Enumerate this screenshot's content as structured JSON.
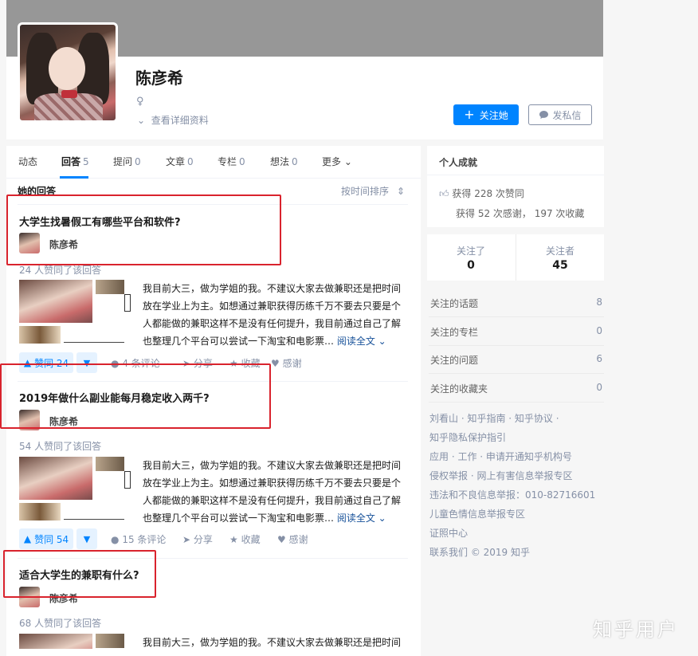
{
  "profile": {
    "name": "陈彦希",
    "gender_symbol": "♀",
    "detail_link": "查看详细资料",
    "follow_button": "关注她",
    "message_button": "发私信"
  },
  "tabs": [
    {
      "label": "动态",
      "count": ""
    },
    {
      "label": "回答",
      "count": "5"
    },
    {
      "label": "提问",
      "count": "0"
    },
    {
      "label": "文章",
      "count": "0"
    },
    {
      "label": "专栏",
      "count": "0"
    },
    {
      "label": "想法",
      "count": "0"
    },
    {
      "label": "更多",
      "count": ""
    }
  ],
  "list": {
    "title": "她的回答",
    "sort": "按时间排序"
  },
  "answers": [
    {
      "question": "大学生找暑假工有哪些平台和软件?",
      "author": "陈彦希",
      "upvote_info": "24 人赞同了该回答",
      "excerpt": "我目前大三，做为学姐的我。不建议大家去做兼职还是把时间放在学业上为主。如想通过兼职获得历练千万不要去只要是个人都能做的兼职这样不是没有任何提升，我目前通过自己了解也整理几个平台可以尝试一下淘宝和电影票…",
      "read_more": "阅读全文",
      "vote": "赞同 24",
      "comments": "4 条评论",
      "share": "分享",
      "collect": "收藏",
      "thanks": "感谢"
    },
    {
      "question": "2019年做什么副业能每月稳定收入两千?",
      "author": "陈彦希",
      "upvote_info": "54 人赞同了该回答",
      "excerpt": "我目前大三，做为学姐的我。不建议大家去做兼职还是把时间放在学业上为主。如想通过兼职获得历练千万不要去只要是个人都能做的兼职这样不是没有任何提升，我目前通过自己了解也整理几个平台可以尝试一下淘宝和电影票…",
      "read_more": "阅读全文",
      "vote": "赞同 54",
      "comments": "15 条评论",
      "share": "分享",
      "collect": "收藏",
      "thanks": "感谢"
    },
    {
      "question": "适合大学生的兼职有什么?",
      "author": "陈彦希",
      "upvote_info": "68 人赞同了该回答",
      "excerpt": "我目前大三，做为学姐的我。不建议大家去做兼职还是把时间放在学业上为主。",
      "read_more": "",
      "vote": "",
      "comments": "",
      "share": "",
      "collect": "",
      "thanks": ""
    }
  ],
  "sidebar": {
    "achievements_title": "个人成就",
    "achievement_votes": "获得 228 次赞同",
    "achievement_thanks": "获得 52 次感谢， 197 次收藏",
    "following_label": "关注了",
    "following_count": "0",
    "followers_label": "关注者",
    "followers_count": "45",
    "rows": [
      {
        "label": "关注的话题",
        "count": "8"
      },
      {
        "label": "关注的专栏",
        "count": "0"
      },
      {
        "label": "关注的问题",
        "count": "6"
      },
      {
        "label": "关注的收藏夹",
        "count": "0"
      }
    ],
    "footer": [
      "刘看山 · 知乎指南 · 知乎协议 ·",
      "知乎隐私保护指引",
      "应用 · 工作 · 申请开通知乎机构号",
      "侵权举报 · 网上有害信息举报专区",
      "违法和不良信息举报：010-82716601",
      "儿童色情信息举报专区",
      "证照中心",
      "联系我们 © 2019 知乎"
    ]
  },
  "watermark": "知乎用户",
  "colors": {
    "accent": "#0084ff",
    "highlight_box": "#d9232d",
    "cover": "#979797"
  }
}
